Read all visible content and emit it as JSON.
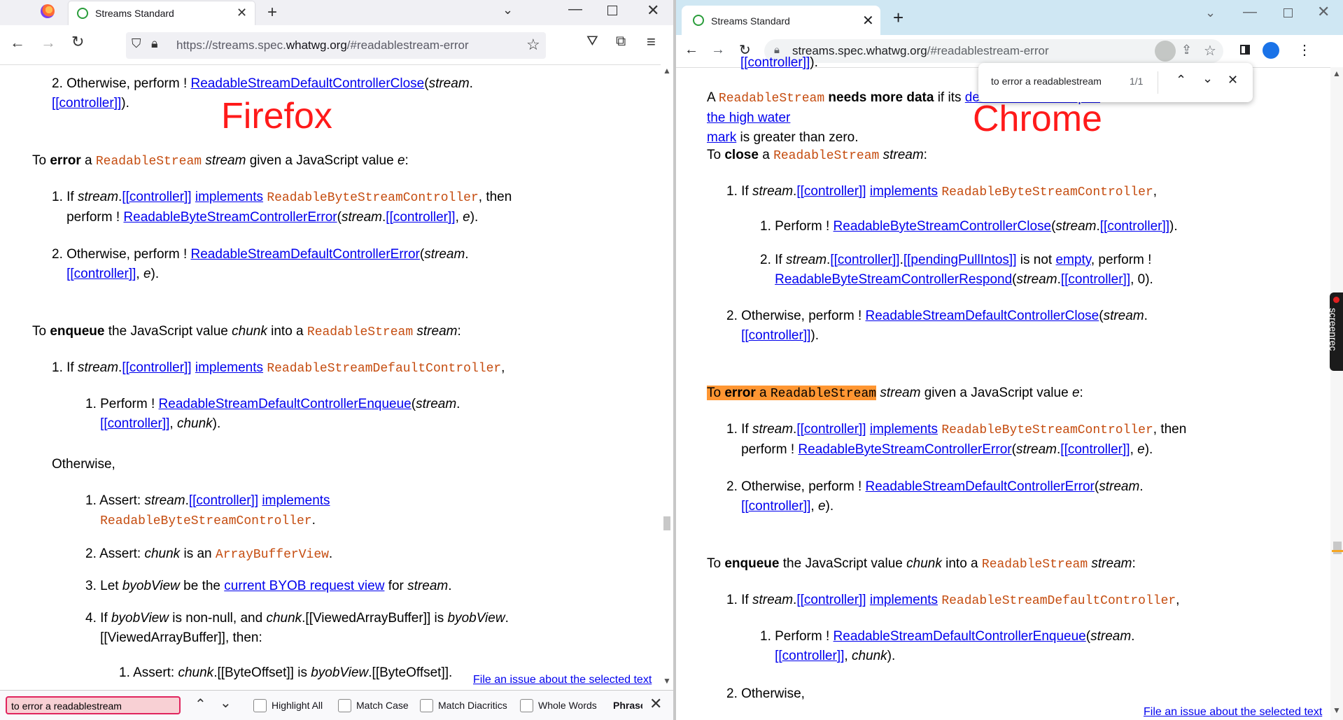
{
  "firefox": {
    "tab_title": "Streams Standard",
    "url_host": "https://streams.spec.",
    "url_domain": "whatwg.org",
    "url_path": "/#readablestream-error",
    "label": "Firefox",
    "file_issue": "File an issue about the selected text",
    "find": {
      "query": "to error a readablestream",
      "highlight_all": "Highlight All",
      "match_case": "Match Case",
      "match_diacritics": "Match Diacritics",
      "whole_words": "Whole Words",
      "phrase": "Phrase"
    }
  },
  "chrome": {
    "tab_title": "Streams Standard",
    "url_domain": "streams.spec.whatwg.org",
    "url_path": "/#readablestream-error",
    "label": "Chrome",
    "file_issue": "File an issue about the selected text",
    "find": {
      "query": "to error a readablestream",
      "count": "1/1"
    },
    "screenrec": "screenrec"
  },
  "spec": {
    "otherwise_perform": "Otherwise, perform !",
    "RSDCClose": "ReadableStreamDefaultControllerClose",
    "RSDCError": "ReadableStreamDefaultControllerError",
    "RSDCEnqueue": "ReadableStreamDefaultControllerEnqueue",
    "RBSCClose": "ReadableByteStreamControllerClose",
    "RBSCError": "ReadableByteStreamControllerError",
    "RBSCRespond": "ReadableByteStreamControllerRespond",
    "ReadableStream": "ReadableStream",
    "ReadableByteStreamController": "ReadableByteStreamController",
    "ReadableStreamDefaultController": "ReadableStreamDefaultController",
    "ArrayBufferView": "ArrayBufferView",
    "controller": "[[controller]]",
    "pendingPullIntos": "[[pendingPullIntos]]",
    "implements": "implements",
    "empty": "empty",
    "current_byob": "current BYOB request view",
    "desired_size": "desired size to fill up to the high water",
    "mark": "mark",
    "needs_more_data": "needs more data",
    "close": "close",
    "error": "error",
    "enqueue": "enqueue",
    "otherwise": "Otherwise,"
  }
}
